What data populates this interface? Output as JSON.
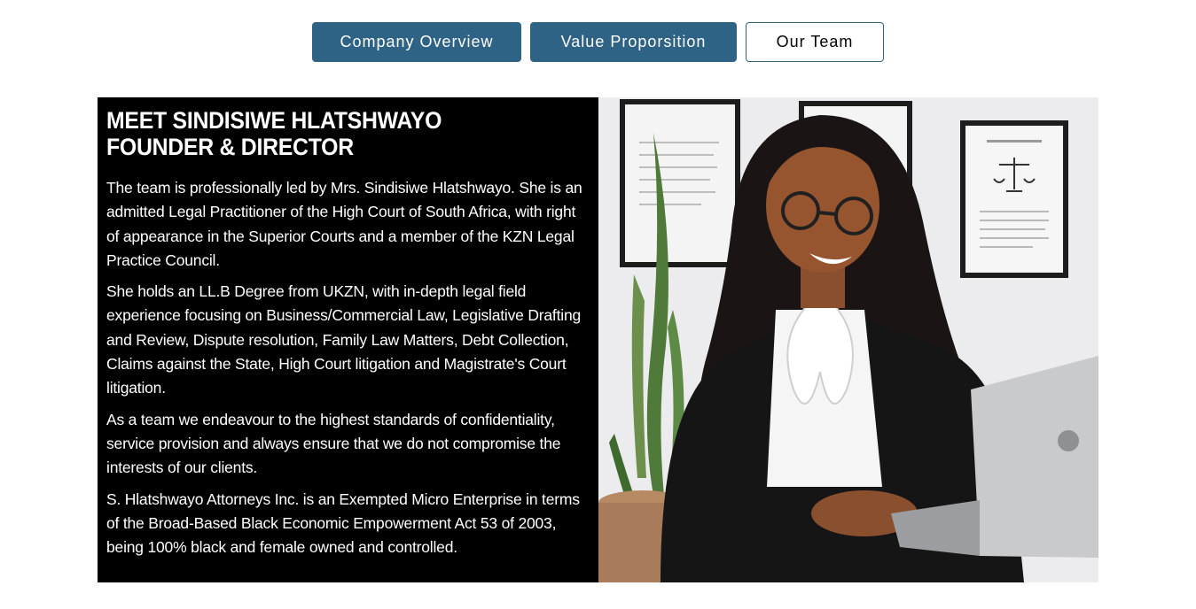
{
  "tabs": [
    {
      "label": "Company Overview",
      "active": false
    },
    {
      "label": "Value Proporsition",
      "active": false
    },
    {
      "label": "Our Team",
      "active": true
    }
  ],
  "profile": {
    "heading_line1": "MEET SINDISIWE HLATSHWAYO",
    "heading_line2": "FOUNDER & DIRECTOR",
    "paragraphs": [
      "The team is professionally led by Mrs. Sindisiwe Hlatshwayo. She is an admitted Legal Practitioner of the High Court of South Africa, with right of appearance in the Superior Courts and a member of the KZN Legal Practice Council.",
      "She holds an LL.B Degree from UKZN, with in-depth legal field experience focusing on Business/Commercial Law, Legislative Drafting and Review, Dispute resolution, Family Law Matters, Debt Collection, Claims against the State, High Court litigation and Magistrate's Court litigation.",
      "As a team we endeavour to the highest standards of confidentiality, service provision and always ensure that we do not compromise the interests of our clients.",
      "S. Hlatshwayo Attorneys Inc. is an Exempted Micro Enterprise in terms of the Broad-Based Black Economic Empowerment Act 53 of 2003, being 100% black and female owned and controlled."
    ]
  },
  "colors": {
    "tab_fill": "#2e6386",
    "panel_bg": "#000000",
    "panel_text": "#ffffff"
  }
}
